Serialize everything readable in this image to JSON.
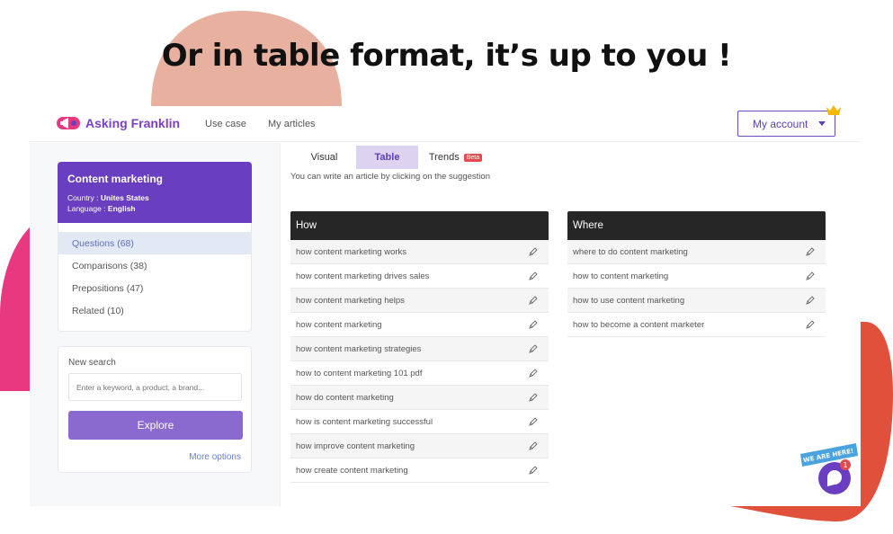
{
  "hero": {
    "title": "Or in table format, it’s up to you !"
  },
  "topbar": {
    "logo_icon": "megaphone-icon",
    "brand": "Asking Franklin",
    "nav": [
      "Use case",
      "My articles"
    ],
    "account_label": "My account",
    "crown_icon": "crown-icon"
  },
  "sidebar": {
    "topic": {
      "title": "Content marketing",
      "country_label": "Country :",
      "country": "Unites States",
      "language_label": "Language :",
      "language": "English"
    },
    "categories": [
      {
        "label": "Questions (68)",
        "active": true
      },
      {
        "label": "Comparisons (38)",
        "active": false
      },
      {
        "label": "Prepositions (47)",
        "active": false
      },
      {
        "label": "Related (10)",
        "active": false
      }
    ],
    "search": {
      "label": "New search",
      "placeholder": "Enter a keyword, a product, a brand...",
      "button": "Explore",
      "more": "More options"
    }
  },
  "tabs": [
    {
      "label": "Visual",
      "active": false
    },
    {
      "label": "Table",
      "active": true
    },
    {
      "label": "Trends",
      "active": false,
      "badge": "Beta"
    }
  ],
  "hint": "You can write an article by clicking on the suggestion",
  "tables": {
    "how": {
      "header": "How",
      "rows": [
        "how content marketing works",
        "how content marketing drives sales",
        "how content marketing helps",
        "how content marketing",
        "how content marketing strategies",
        "how to content marketing 101 pdf",
        "how do content marketing",
        "how is content marketing successful",
        "how improve content marketing",
        "how create content marketing"
      ]
    },
    "where": {
      "header": "Where",
      "rows": [
        "where to do content marketing",
        "how to content marketing",
        "how to use content marketing",
        "how to become a content marketer"
      ]
    }
  },
  "chat": {
    "badge_text": "WE ARE HERE!",
    "unread": "1",
    "icon": "chat-bubble-icon"
  },
  "colors": {
    "accent": "#6a3ec0",
    "button": "#8b6ad0",
    "blob_peach": "#e8b09e",
    "blob_pink": "#e8387f",
    "blob_orange": "#e0503a"
  }
}
